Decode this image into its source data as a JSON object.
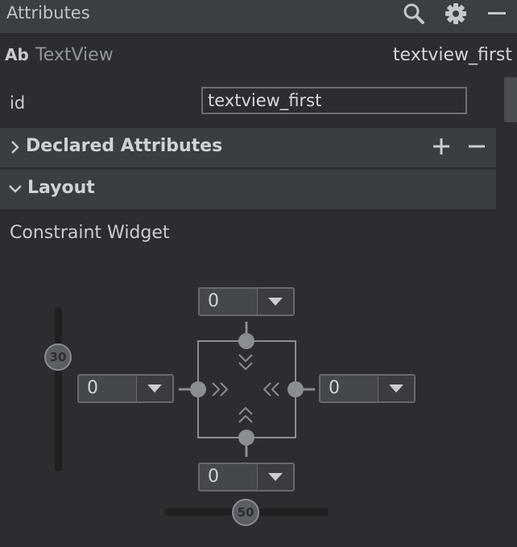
{
  "panel": {
    "title": "Attributes",
    "icons": [
      "search-icon",
      "gear-icon",
      "minimize-icon"
    ]
  },
  "component": {
    "badge": "Ab",
    "type": "TextView",
    "id": "textview_first"
  },
  "attributes": {
    "id_label": "id",
    "id_value": "textview_first"
  },
  "sections": {
    "declared": {
      "label": "Declared Attributes",
      "expanded": false
    },
    "layout": {
      "label": "Layout",
      "expanded": true
    }
  },
  "constraint_widget": {
    "label": "Constraint Widget",
    "margin_top": "0",
    "margin_left": "0",
    "margin_right": "0",
    "margin_bottom": "0",
    "vertical_bias": "30",
    "horizontal_bias": "50"
  },
  "colors": {
    "background": "#2b2d30",
    "header": "#3c3f41",
    "section": "#3b3e41",
    "widget_line": "#8a8d91"
  }
}
